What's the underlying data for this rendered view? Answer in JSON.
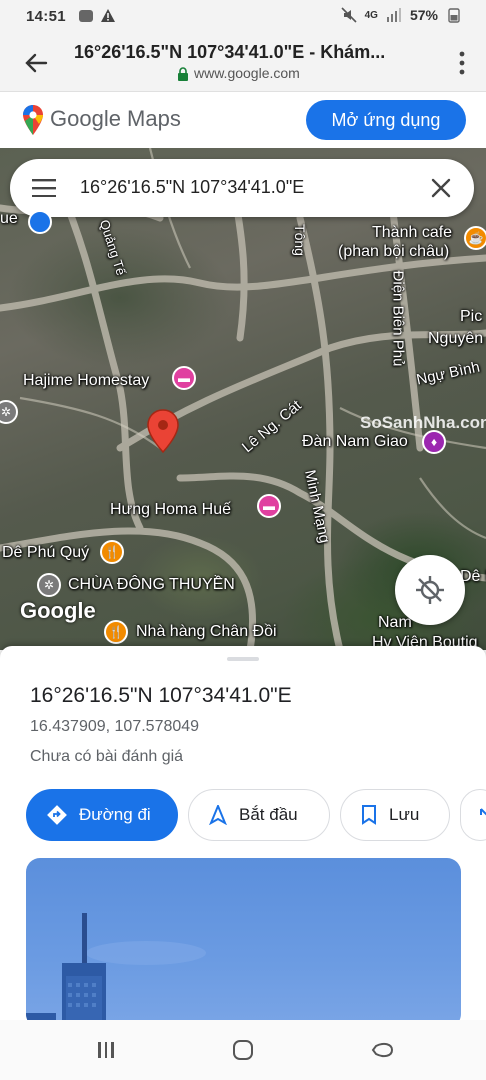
{
  "status_bar": {
    "time": "14:51",
    "network": "4G",
    "battery": "57%"
  },
  "browser": {
    "title": "16°26'16.5\"N 107°34'41.0\"E - Khám...",
    "url": "www.google.com"
  },
  "maps_header": {
    "brand": "Google Maps",
    "open_app_label": "Mở ứng dụng"
  },
  "search": {
    "query": "16°26'16.5\"N 107°34'41.0\"E"
  },
  "map": {
    "labels": [
      "Thành cafe",
      "(phan bội châu)",
      "Quảng Tế",
      "Tông",
      "Điện Biên Phủ",
      "Pic",
      "Nguyên",
      "Ngự Bình",
      "Hajime Homestay",
      "Lê Ng. Cát",
      "Đàn Nam Giao",
      "Minh Mạng",
      "Hưng Homa  Huế",
      "Dê Phú Quý",
      "CHÙA ĐÔNG THUYỀN",
      "Nhà hàng Chân Đồi",
      "Nam",
      "Hy Viện Boutiq",
      "ue",
      "Dê N"
    ],
    "google_logo": "Google",
    "watermark": "SoSanhNha.com"
  },
  "place": {
    "title": "16°26'16.5\"N 107°34'41.0\"E",
    "coordinates": "16.437909, 107.578049",
    "reviews": "Chưa có bài đánh giá"
  },
  "actions": {
    "directions": "Đường đi",
    "start": "Bắt đầu",
    "save": "Lưu"
  },
  "colors": {
    "accent": "#1a73e8",
    "pin": "#ea4335"
  }
}
